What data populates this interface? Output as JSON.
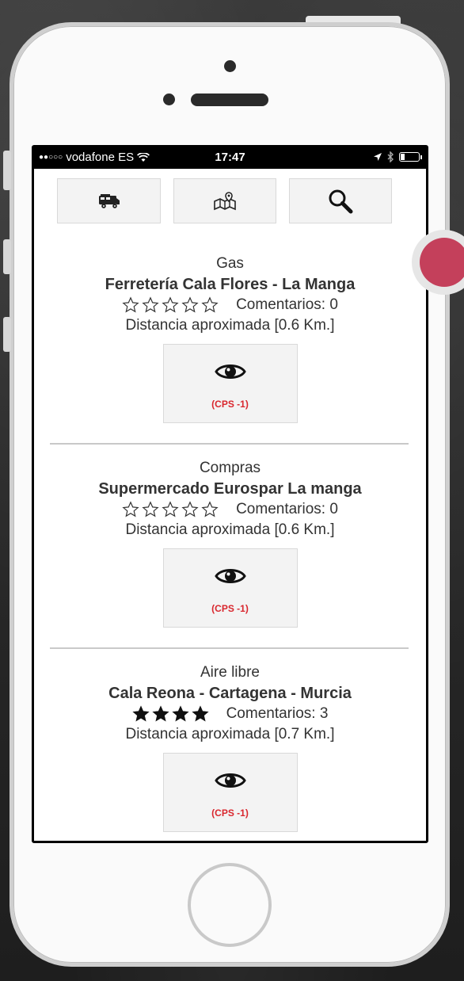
{
  "status_bar": {
    "signal_dots": "●●○○○",
    "carrier": "vodafone ES",
    "time": "17:47"
  },
  "toolbar": {
    "buttons": [
      {
        "icon": "camper-van-icon"
      },
      {
        "icon": "map-pin-icon"
      },
      {
        "icon": "search-icon"
      }
    ]
  },
  "listings": [
    {
      "category": "Gas",
      "name": "Ferretería Cala Flores - La Manga",
      "rating": 0,
      "comments": "Comentarios: 0",
      "distance": "Distancia aproximada [0.6 Km.]",
      "cps": "(CPS -1)"
    },
    {
      "category": "Compras",
      "name": "Supermercado Eurospar La manga",
      "rating": 0,
      "comments": "Comentarios: 0",
      "distance": "Distancia aproximada [0.6 Km.]",
      "cps": "(CPS -1)"
    },
    {
      "category": "Aire libre",
      "name": "Cala Reona - Cartagena - Murcia",
      "rating": 4,
      "comments": "Comentarios: 3",
      "distance": "Distancia aproximada [0.7 Km.]",
      "cps": "(CPS -1)"
    }
  ],
  "colors": {
    "accent": "#c4405b",
    "cps_text": "#d9272e"
  }
}
